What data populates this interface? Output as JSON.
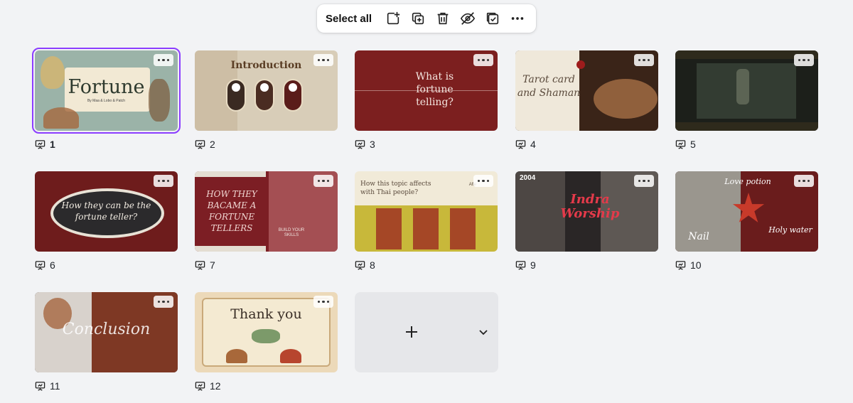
{
  "toolbar": {
    "select_all": "Select all",
    "icons": [
      "add-page-icon",
      "duplicate-icon",
      "trash-icon",
      "hide-icon",
      "check-box-icon",
      "more-icon"
    ]
  },
  "accent": "#8b3dff",
  "slides": [
    {
      "number": "1",
      "title": "Fortune",
      "subtitle": "By Maa & Lobo & Patch",
      "selected": true
    },
    {
      "number": "2",
      "title": "Introduction"
    },
    {
      "number": "3",
      "title": "What is fortune telling?"
    },
    {
      "number": "4",
      "title": "Tarot card and Shaman"
    },
    {
      "number": "5",
      "title": ""
    },
    {
      "number": "6",
      "title": "How they can be the fortune teller?"
    },
    {
      "number": "7",
      "title": "HOW THEY BACAME A FORTUNE TELLERS",
      "extra": "BUILD YOUR SKILLS"
    },
    {
      "number": "8",
      "title": "How this topic affects with Thai people?",
      "extra": "Affe"
    },
    {
      "number": "9",
      "title": "Indra Worship",
      "extra": "2004"
    },
    {
      "number": "10",
      "title": "Love potion",
      "extra": "Holy water",
      "extra2": "Nail"
    },
    {
      "number": "11",
      "title": "Conclusion"
    },
    {
      "number": "12",
      "title": "Thank you"
    }
  ]
}
